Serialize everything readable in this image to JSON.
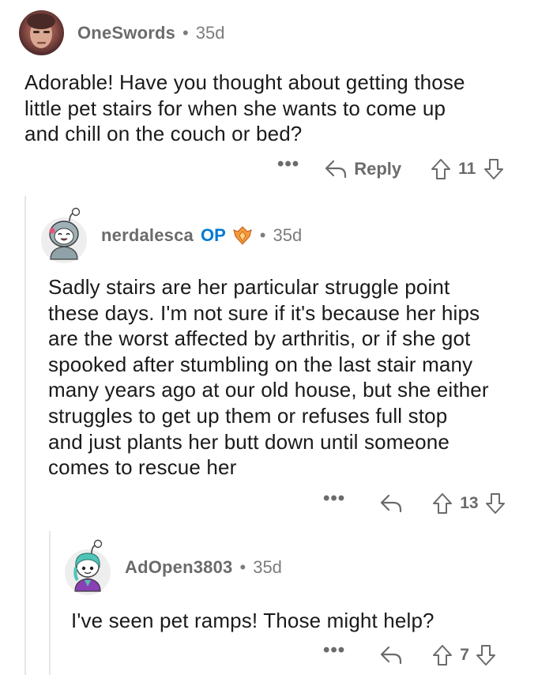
{
  "comments": [
    {
      "username": "OneSwords",
      "age": "35d",
      "separator": "•",
      "body_lines": [
        "Adorable! Have you thought about getting those",
        "little pet stairs for when she wants to come up",
        "and chill on the couch or bed?"
      ],
      "more": "•••",
      "reply_label": "Reply",
      "votes": "11"
    },
    {
      "username": "nerdalesca",
      "op_label": "OP",
      "age": "35d",
      "separator": "•",
      "body_lines": [
        "Sadly stairs are her particular struggle point",
        "these days. I'm not sure if it's because her hips",
        "are the worst affected by arthritis, or if she got",
        "spooked after stumbling on the last stair many",
        "many years ago at our old house, but she either",
        "struggles to get up them or refuses full stop",
        "and just plants her butt down until someone",
        "comes to rescue her"
      ],
      "more": "•••",
      "votes": "13"
    },
    {
      "username": "AdOpen3803",
      "age": "35d",
      "separator": "•",
      "body_lines": [
        "I've seen pet ramps! Those might help?"
      ],
      "more": "•••",
      "votes": "7"
    }
  ],
  "colors": {
    "text": "#1a1a1b",
    "meta": "#7c7c7c",
    "op": "#0079d3",
    "thread_line": "#e6e6e6"
  },
  "icons": {
    "reply": "reply-arrow-icon",
    "upvote": "upvote-arrow-icon",
    "downvote": "downvote-arrow-icon",
    "award": "award-icon"
  }
}
